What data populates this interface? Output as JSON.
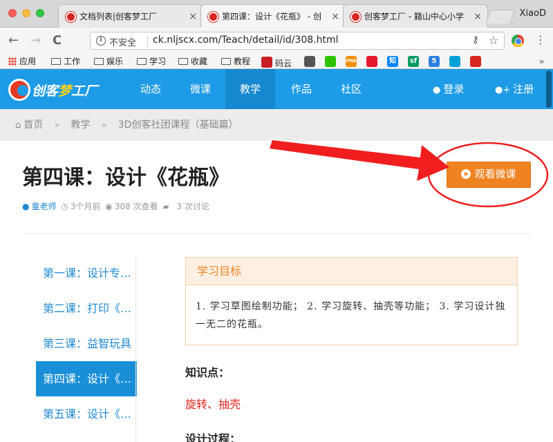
{
  "browser": {
    "tabs": [
      {
        "title": "文档列表|创客梦工厂",
        "active": false
      },
      {
        "title": "第四课：设计《花瓶》 - 创",
        "active": true
      },
      {
        "title": "创客梦工厂 - 籍山中心小学",
        "active": false
      }
    ],
    "tab_close": "×",
    "profile": "XiaoD",
    "back": "←",
    "forward": "→",
    "reload": "C",
    "info_glyph": "i",
    "security_label": "不安全",
    "url": "ck.nljscx.com/Teach/detail/id/308.html",
    "key_glyph": "⚷",
    "star_glyph": "☆",
    "menu_glyph": "⋮",
    "bookmarks": [
      "应用",
      "工作",
      "娱乐",
      "学习",
      "收藏",
      "教程",
      "码云"
    ],
    "bookmark_icons": [
      {
        "label": "",
        "color": "#555555",
        "name": "hat-icon"
      },
      {
        "label": "",
        "color": "#2dc100",
        "name": "wechat-icon"
      },
      {
        "label": "PMA",
        "color": "#f29111",
        "name": "phpmyadmin-icon"
      },
      {
        "label": "",
        "color": "#e6162d",
        "name": "weibo-icon"
      },
      {
        "label": "知",
        "color": "#0084ff",
        "name": "zhihu-icon"
      },
      {
        "label": "sf",
        "color": "#009a61",
        "name": "segmentfault-icon"
      },
      {
        "label": "5",
        "color": "#2a7ee0",
        "name": "five-icon"
      },
      {
        "label": "",
        "color": "#00a1d6",
        "name": "bilibili-icon"
      },
      {
        "label": "",
        "color": "#d7261e",
        "name": "dreamfactory-icon"
      }
    ],
    "more_glyph": "»"
  },
  "site": {
    "logo_parts": [
      "创客",
      "梦",
      "工厂"
    ],
    "nav": [
      "动态",
      "微课",
      "教学",
      "作品",
      "社区"
    ],
    "active_nav": "教学",
    "login": "登录",
    "register": "注册",
    "brand_color": "#1e9be6",
    "accent_color": "#ef8321"
  },
  "breadcrumb": [
    "首页",
    "教学",
    "3D创客社团课程（基础篇）"
  ],
  "breadcrumb_sep": "»",
  "lesson": {
    "title": "第四课：设计《花瓶》",
    "author": "童老师",
    "time": "3个月前",
    "views": "308 次查看",
    "comments": "3 次讨论",
    "watch_button": "观看微课"
  },
  "sidebar": {
    "lessons": [
      {
        "label": "第一课：设计专属名牌",
        "active": false
      },
      {
        "label": "第二课：打印《笔筒》",
        "active": false
      },
      {
        "label": "第三课：益智玩具",
        "active": false
      },
      {
        "label": "第四课：设计《花瓶》",
        "active": true
      },
      {
        "label": "第五课：设计《台灯》",
        "active": false
      }
    ]
  },
  "content": {
    "goal_heading": "学习目标",
    "goal_text": "1. 学习草图绘制功能；  2. 学习旋转、抽壳等功能；  3. 学习设计独一无二的花瓶。",
    "knowledge_label": "知识点：",
    "knowledge_value": "旋转、抽壳",
    "process_label": "设计过程："
  }
}
